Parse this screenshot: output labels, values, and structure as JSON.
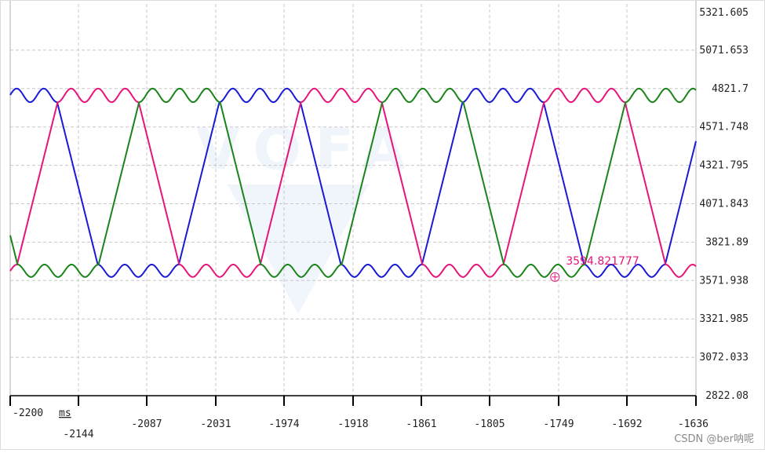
{
  "chart_data": {
    "type": "line",
    "x_unit": "ms",
    "x_ticks": [
      "-2200",
      "-2144",
      "-2087",
      "-2031",
      "-1974",
      "-1918",
      "-1861",
      "-1805",
      "-1749",
      "-1692",
      "-1636"
    ],
    "y_ticks": [
      "5321.605",
      "5071.653",
      "4821.7",
      "4571.748",
      "4321.795",
      "4071.843",
      "3821.89",
      "3571.938",
      "3321.985",
      "3072.033",
      "2822.08"
    ],
    "xlim": [
      -2200,
      -1636
    ],
    "ylim": [
      2822.08,
      5321.605
    ],
    "grid": true,
    "grid_style": "dashed",
    "wave": {
      "period_ms": 200,
      "upper_value": 4821.7,
      "upper_peak": 4821.7,
      "upper_dip": 4733,
      "lower_value": 3594.82,
      "lower_dip": 3594.82,
      "lower_peak": 3676
    },
    "series": [
      {
        "color": "#1a1ad6",
        "phase_ms": -2228
      },
      {
        "color": "#e8147a",
        "phase_ms": -2161
      },
      {
        "color": "#1a841a",
        "phase_ms": -2294
      }
    ],
    "annotation": {
      "text": "3594.821777",
      "x": -1752,
      "y": 3594.82,
      "color": "#e8147a"
    }
  },
  "watermark": "CSDN @ber呐呢"
}
